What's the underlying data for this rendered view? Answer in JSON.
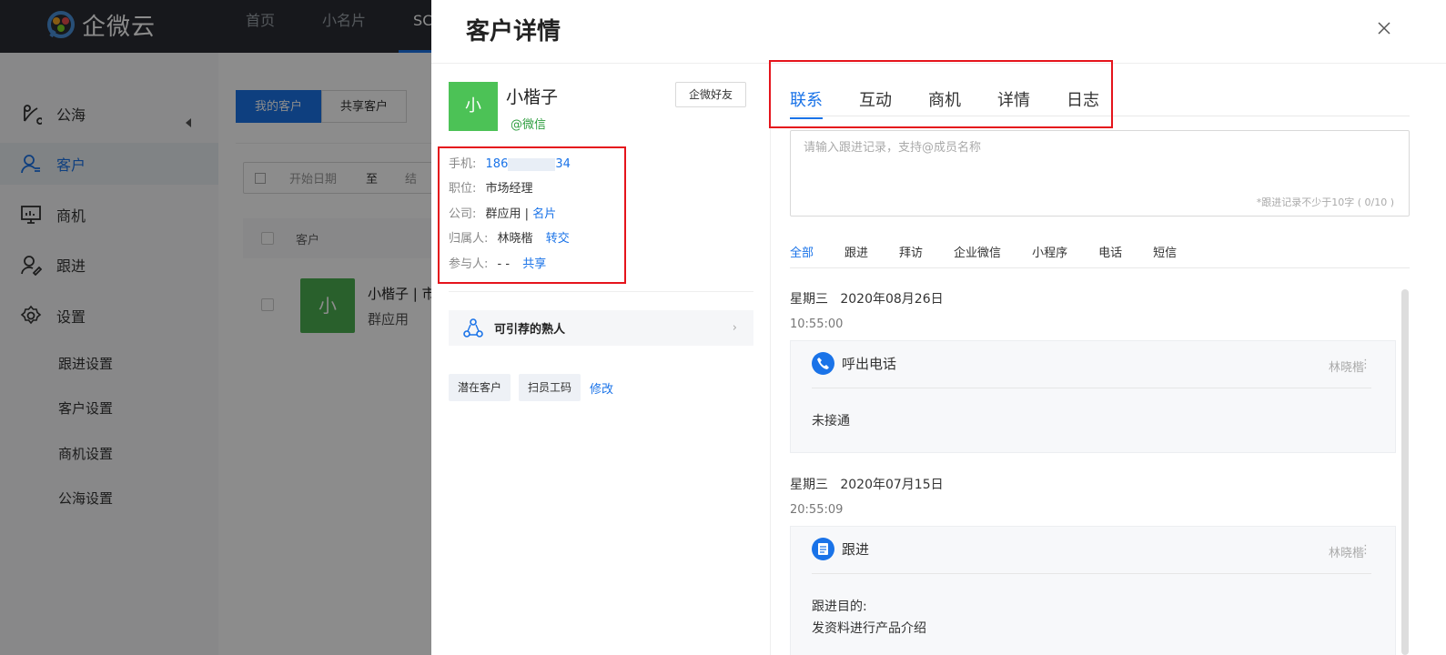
{
  "topbar": {
    "logo_text": "企微云",
    "nav": [
      "首页",
      "小名片",
      "SCRM"
    ]
  },
  "sidebar": {
    "items": [
      {
        "label": "公海",
        "icon": "sea-icon"
      },
      {
        "label": "客户",
        "icon": "customer-icon"
      },
      {
        "label": "商机",
        "icon": "monitor-icon"
      },
      {
        "label": "跟进",
        "icon": "followup-icon"
      },
      {
        "label": "设置",
        "icon": "gear-icon"
      }
    ],
    "sub_items": [
      "跟进设置",
      "客户设置",
      "商机设置",
      "公海设置"
    ]
  },
  "list": {
    "tab_mine": "我的客户",
    "tab_shared": "共享客户",
    "start_date": "开始日期",
    "to": "至",
    "end_date": "结",
    "col_customer": "客户",
    "row_avatar": "小",
    "row_name": "小楷子 | 市",
    "row_company": "群应用"
  },
  "drawer": {
    "title": "客户详情",
    "customer": {
      "avatar": "小",
      "name": "小楷子",
      "wechat": "@微信",
      "friend_button": "企微好友",
      "phone_label": "手机:",
      "phone_start": "186",
      "phone_end": "34",
      "title_label": "职位:",
      "title_value": "市场经理",
      "company_label": "公司:",
      "company_value": "群应用 |",
      "company_link": "名片",
      "owner_label": "归属人:",
      "owner_value": "林晓楷",
      "owner_link": "转交",
      "participant_label": "参与人:",
      "participant_value": "- -",
      "participant_link": "共享"
    },
    "recommend": "可引荐的熟人",
    "tags": [
      "潜在客户",
      "扫员工码"
    ],
    "edit_link": "修改",
    "tabs": [
      "联系",
      "互动",
      "商机",
      "详情",
      "日志"
    ],
    "input": {
      "placeholder": "请输入跟进记录，支持@成员名称",
      "counter": "*跟进记录不少于10字 ( 0/10 )"
    },
    "filters": [
      "全部",
      "跟进",
      "拜访",
      "企业微信",
      "小程序",
      "电话",
      "短信"
    ],
    "timeline": [
      {
        "date": "星期三   2020年08月26日",
        "time": "10:55:00",
        "type": "呼出电话",
        "user": "林晓楷",
        "content": "未接通"
      },
      {
        "date": "星期三   2020年07月15日",
        "time": "20:55:09",
        "type": "跟进",
        "user": "林晓楷",
        "content_1": "跟进目的:",
        "content_2": "发资料进行产品介绍"
      }
    ]
  },
  "colors": {
    "accent": "#1a73e8",
    "highlight": "#e5141c",
    "avatar_green": "#4cc256"
  }
}
